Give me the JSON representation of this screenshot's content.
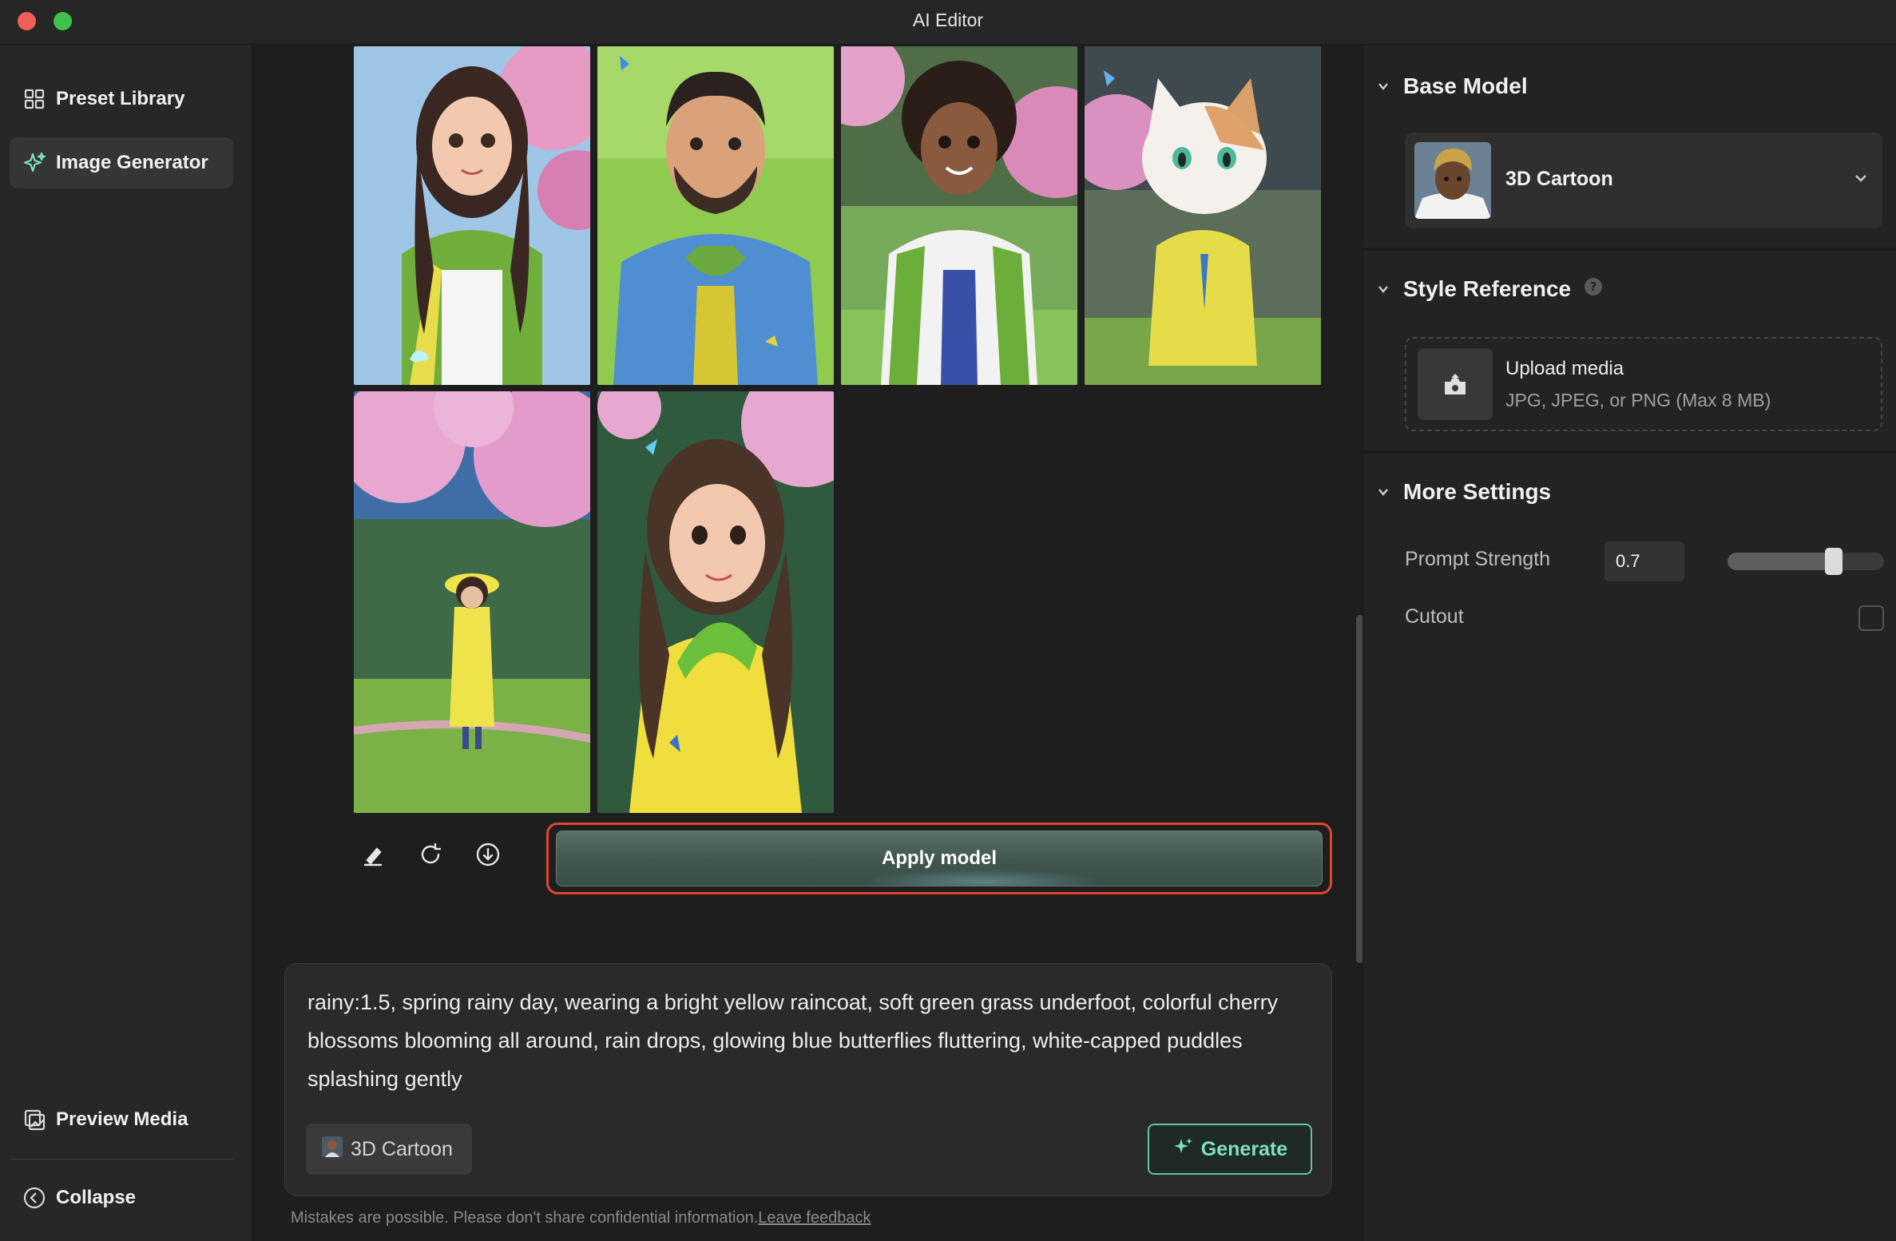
{
  "window": {
    "title": "AI Editor"
  },
  "sidebar": {
    "items": [
      {
        "label": "Preset Library",
        "icon": "grid-icon"
      },
      {
        "label": "Image Generator",
        "icon": "sparkle-icon",
        "active": true
      }
    ],
    "bottom": [
      {
        "label": "Preview Media",
        "icon": "gallery-icon"
      },
      {
        "label": "Collapse",
        "icon": "collapse-icon"
      }
    ]
  },
  "gallery": {
    "images": [
      {
        "name": "girl-green-jacket"
      },
      {
        "name": "man-blue-hoodie"
      },
      {
        "name": "woman-white-coat"
      },
      {
        "name": "cat-yellow-raincoat"
      },
      {
        "name": "child-yellow-raincoat"
      },
      {
        "name": "woman-yellow-raincoat"
      }
    ],
    "toolbar": [
      "edit-icon",
      "refresh-icon",
      "download-icon"
    ],
    "apply_label": "Apply model"
  },
  "prompt": {
    "text": "rainy:1.5, spring rainy day, wearing a bright yellow raincoat, soft green grass underfoot, colorful cherry blossoms blooming all around, rain drops, glowing blue butterflies fluttering, white-capped puddles splashing gently",
    "model_chip": "3D Cartoon",
    "generate_label": "Generate"
  },
  "footer": {
    "disclaimer": "Mistakes are possible. Please don't share confidential information.",
    "feedback_link": "Leave feedback"
  },
  "panel": {
    "base_model": {
      "title": "Base Model",
      "selected": "3D Cartoon"
    },
    "style_reference": {
      "title": "Style Reference",
      "upload_title": "Upload media",
      "upload_hint": "JPG, JPEG, or PNG (Max 8 MB)"
    },
    "more_settings": {
      "title": "More Settings",
      "prompt_strength_label": "Prompt Strength",
      "prompt_strength_value": "0.7",
      "prompt_strength_level": 0.7,
      "cutout_label": "Cutout",
      "cutout_checked": false
    }
  },
  "colors": {
    "accent": "#5ec5a4",
    "highlight_outline": "#e2452d",
    "apply_button": "#40564f"
  }
}
